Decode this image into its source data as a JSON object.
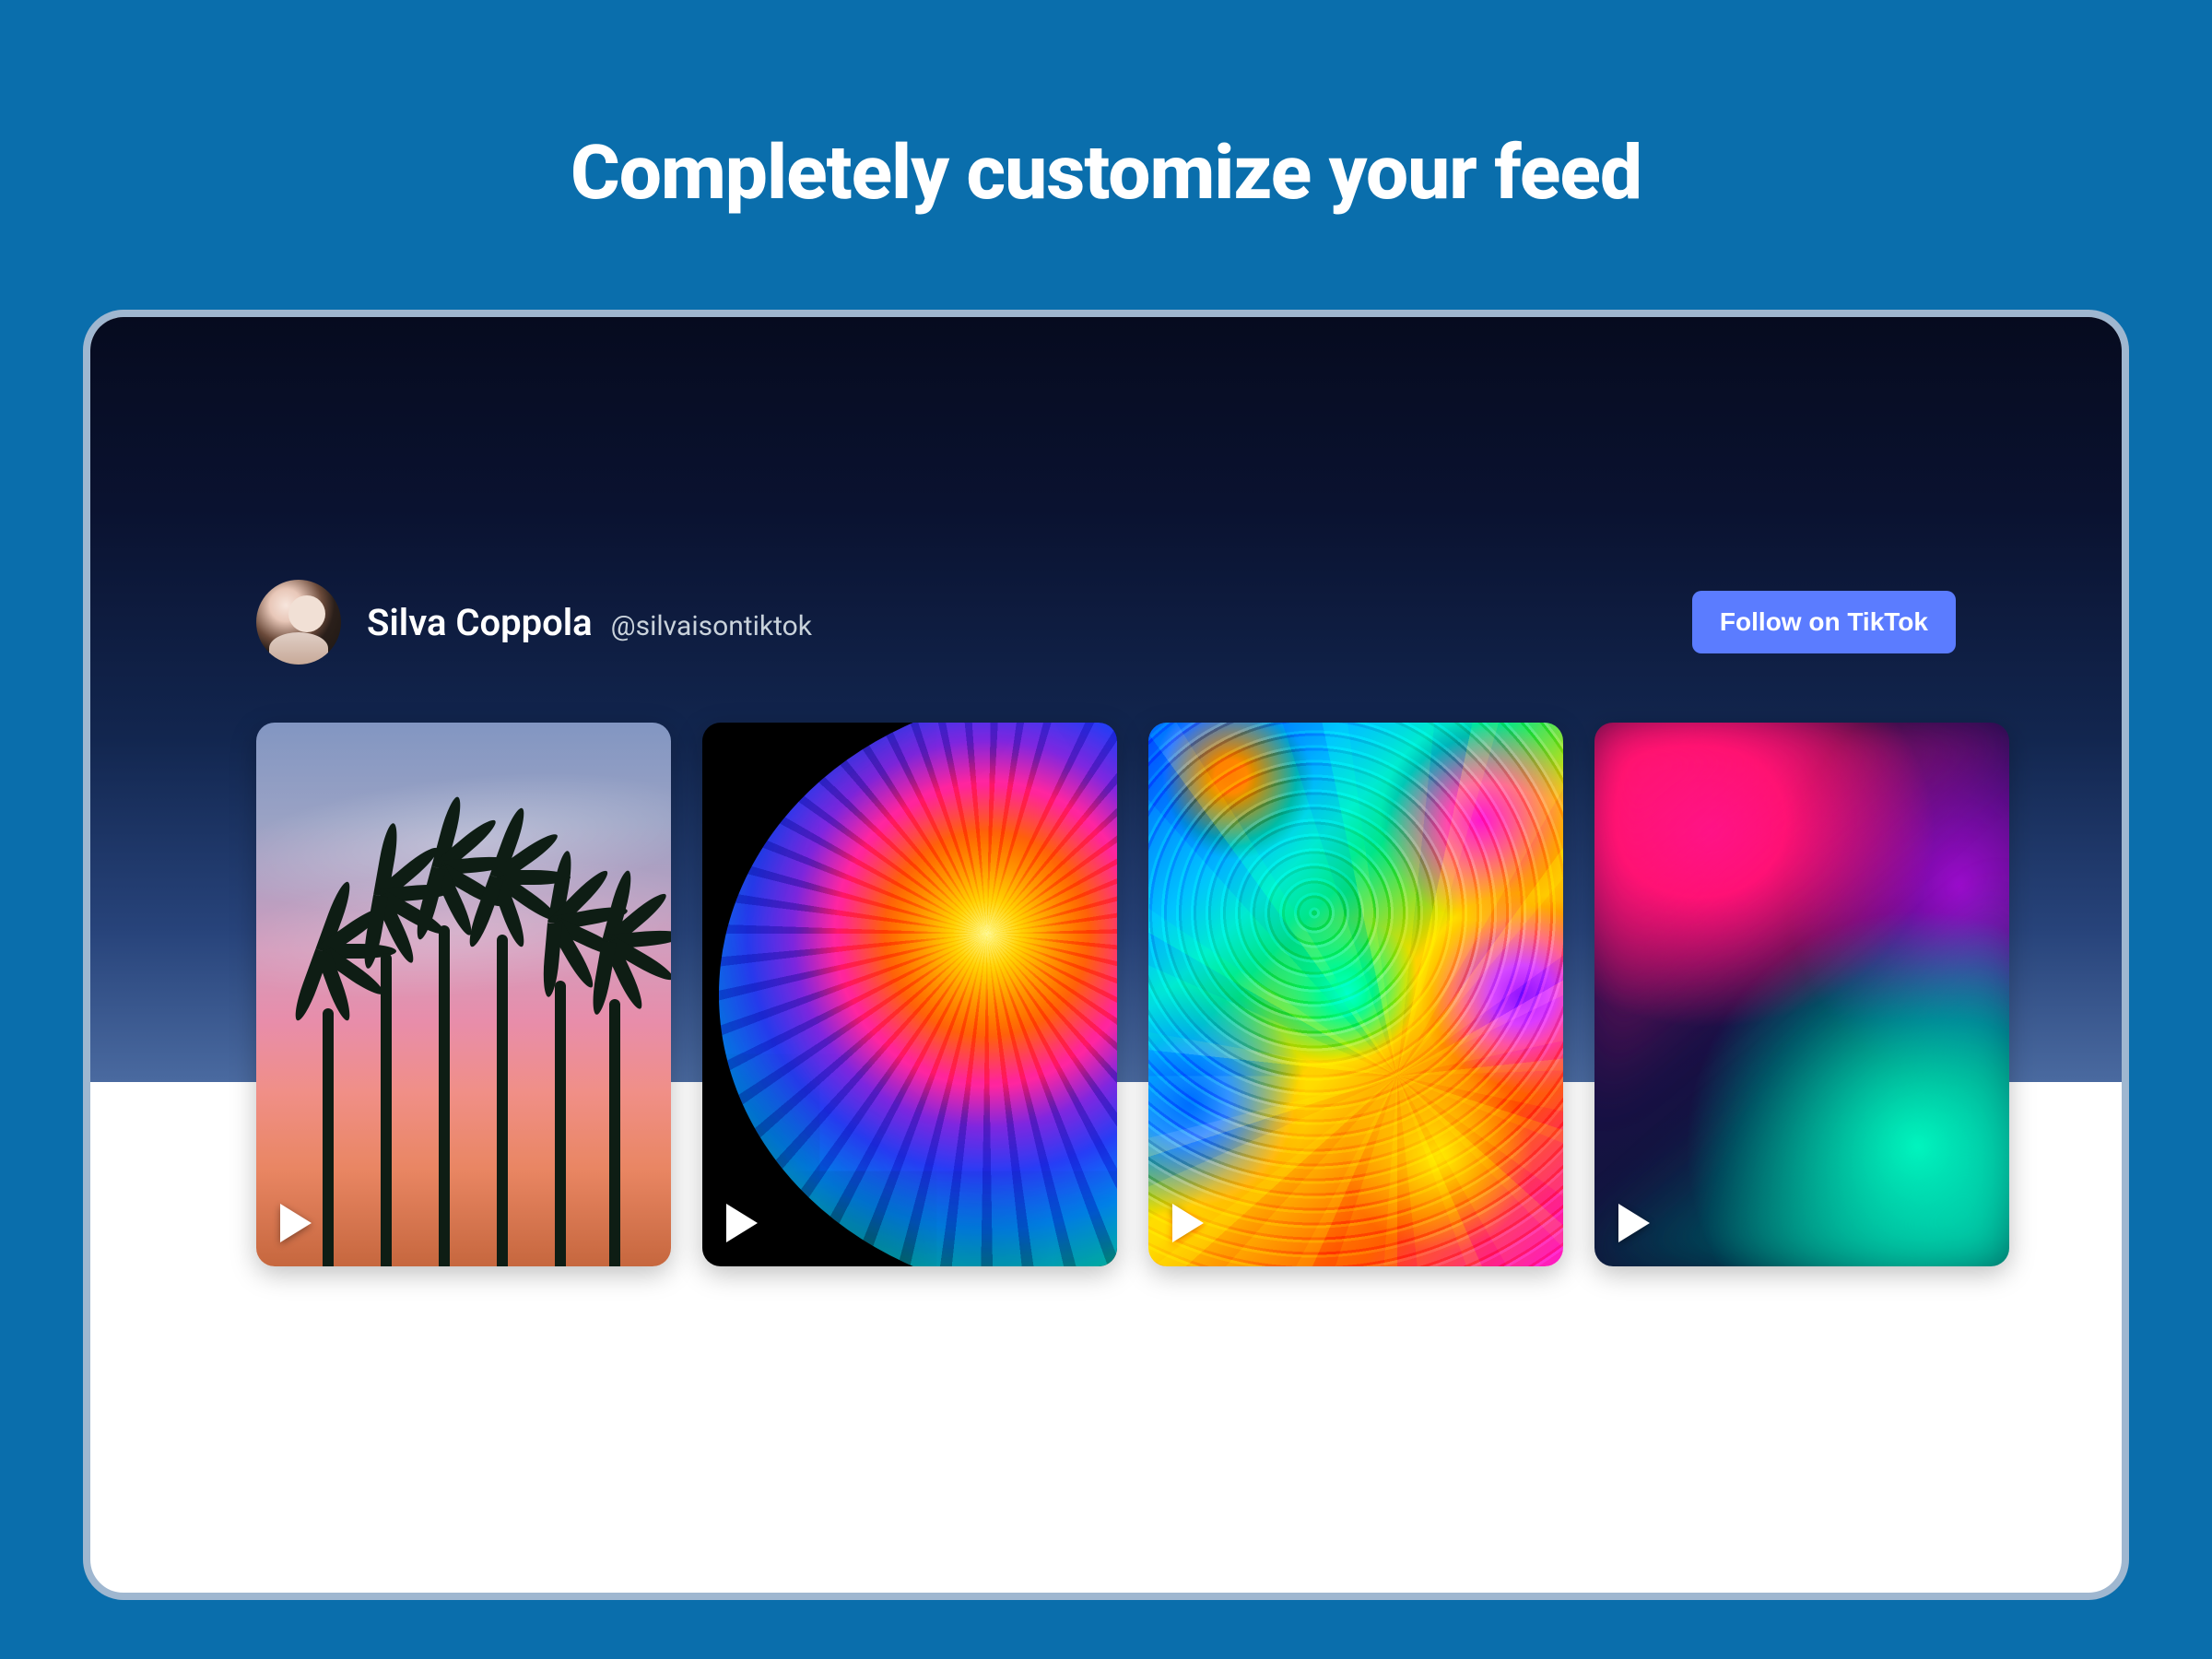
{
  "heading": "Completely customize your feed",
  "profile": {
    "name": "Silva Coppola",
    "handle": "@silvaisontiktok",
    "follow_label": "Follow on TikTok"
  },
  "tiles": [
    {
      "alt": "Palm trees silhouette at sunset"
    },
    {
      "alt": "Iridescent soap bubble planet on black"
    },
    {
      "alt": "Colorful liquid marble swirl"
    },
    {
      "alt": "Blurred magenta and teal gradient"
    }
  ]
}
